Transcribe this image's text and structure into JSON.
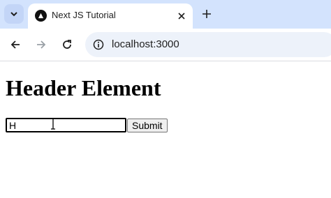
{
  "browser": {
    "tab": {
      "title": "Next JS Tutorial",
      "close_icon": "close-icon",
      "favicon": "nextjs-triangle-icon"
    },
    "new_tab_icon": "plus-icon",
    "tab_menu_icon": "chevron-down-icon",
    "address_bar": {
      "url": "localhost:3000",
      "site_info_icon": "info-icon"
    },
    "nav": {
      "back_icon": "arrow-left-icon",
      "forward_icon": "arrow-right-icon",
      "reload_icon": "reload-icon"
    }
  },
  "page": {
    "heading": "Header Element",
    "form": {
      "input_value": "H",
      "submit_label": "Submit"
    }
  },
  "colors": {
    "tabstrip": "#d3e3fd",
    "omnibox": "#edf2fa",
    "page_background": "#ffffff"
  }
}
